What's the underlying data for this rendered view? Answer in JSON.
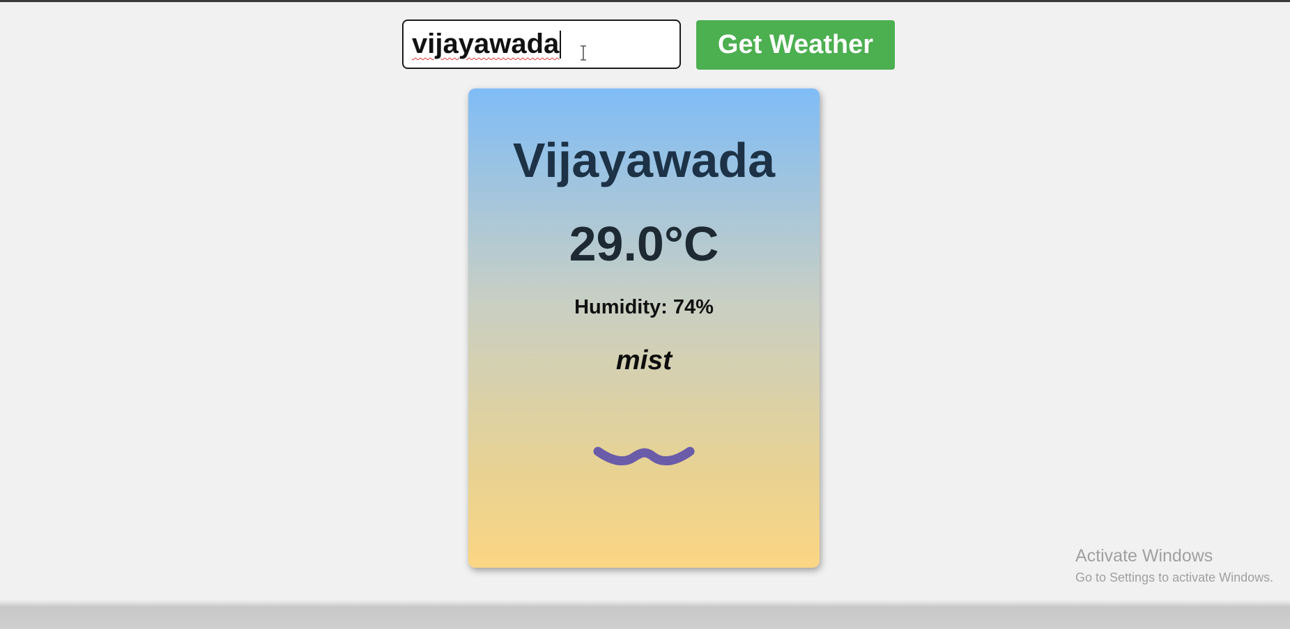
{
  "search": {
    "value": "vijayawada",
    "placeholder": ""
  },
  "button": {
    "label": "Get Weather",
    "color": "#4caf50"
  },
  "card": {
    "city": "Vijayawada",
    "temperature": "29.0°C",
    "humidity": "Humidity: 74%",
    "description": "mist",
    "icon": "mist-wave-icon",
    "icon_color": "#6a5ca8"
  },
  "watermark": {
    "title": "Activate Windows",
    "subtitle": "Go to Settings to activate Windows."
  }
}
